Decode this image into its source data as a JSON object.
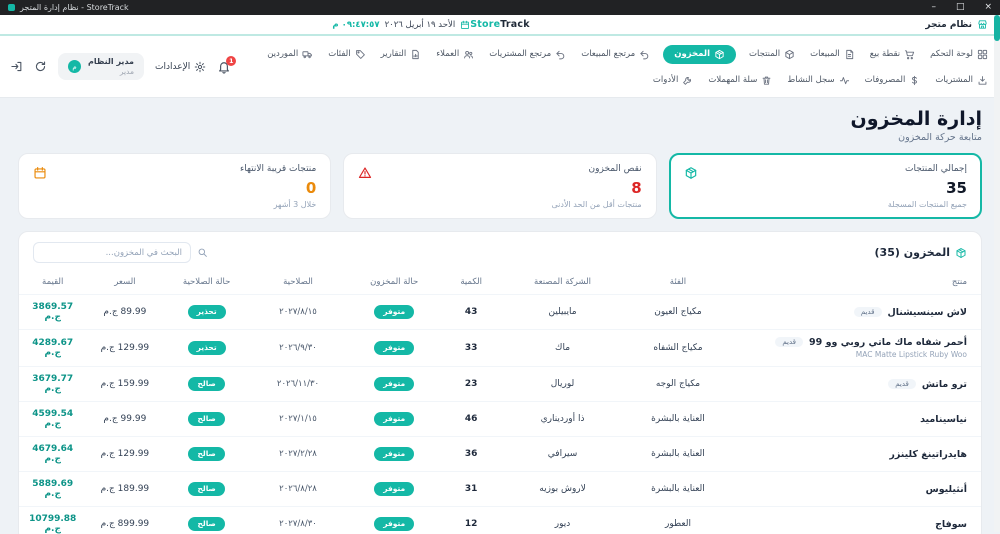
{
  "window": {
    "title": "نظام إدارة المتجر - StoreTrack",
    "minimize": "–",
    "maximize": "□",
    "close": "×"
  },
  "app_header": {
    "system_label": "نظام متجر",
    "brand_store": "Store",
    "brand_track": "Track",
    "date": "الأحد ١٩ أبريل ٢٠٢٦",
    "time": "٠٩:٤٧:٥٧ م"
  },
  "nav": {
    "row1": [
      {
        "label": "لوحة التحكم",
        "icon": "dashboard",
        "active": false
      },
      {
        "label": "نقطة بيع",
        "icon": "pos",
        "active": false
      },
      {
        "label": "المبيعات",
        "icon": "sales",
        "active": false
      },
      {
        "label": "المنتجات",
        "icon": "products",
        "active": false
      },
      {
        "label": "المخزون",
        "icon": "inventory",
        "active": true
      },
      {
        "label": "مرتجع المبيعات",
        "icon": "returns",
        "active": false
      },
      {
        "label": "مرتجع المشتريات",
        "icon": "returns",
        "active": false
      },
      {
        "label": "العملاء",
        "icon": "customers",
        "active": false
      },
      {
        "label": "التقارير",
        "icon": "reports",
        "active": false
      },
      {
        "label": "الفئات",
        "icon": "categories",
        "active": false
      },
      {
        "label": "الموردين",
        "icon": "suppliers",
        "active": false
      }
    ],
    "row2": [
      {
        "label": "المشتريات",
        "icon": "purchases",
        "active": false
      },
      {
        "label": "المصروفات",
        "icon": "expenses",
        "active": false
      },
      {
        "label": "سجل النشاط",
        "icon": "activity",
        "active": false
      },
      {
        "label": "سلة المهملات",
        "icon": "trash",
        "active": false
      },
      {
        "label": "الأدوات",
        "icon": "tools",
        "active": false
      }
    ],
    "actions": {
      "settings_label": "الإعدادات",
      "notification_count": "1",
      "user_name": "مدير النظام",
      "user_role": "مدير",
      "avatar_letter": "م"
    }
  },
  "page": {
    "title": "إدارة المخزون",
    "subtitle": "متابعة حركة المخزون"
  },
  "stats_cards": [
    {
      "id": "total-products",
      "title": "إجمالي المنتجات",
      "value": "35",
      "sub": "جميع المنتجات المسجلة",
      "icon": "inventory",
      "accent": "teal",
      "value_class": "",
      "active": true
    },
    {
      "id": "low-stock",
      "title": "نقص المخزون",
      "value": "8",
      "sub": "منتجات أقل من الحد الأدنى",
      "icon": "warning",
      "accent": "red",
      "value_class": "v-red",
      "active": false
    },
    {
      "id": "near-expiry",
      "title": "منتجات قريبة الانتهاء",
      "value": "0",
      "sub": "خلال 3 أشهر",
      "icon": "calendar",
      "accent": "orange",
      "value_class": "v-orange",
      "active": false
    }
  ],
  "inventory": {
    "section_title": "المخزون (35)",
    "search_placeholder": "البحث في المخزون...",
    "columns": [
      "منتج",
      "الفئة",
      "الشركة المصنعة",
      "الكمية",
      "حالة المخزون",
      "الصلاحية",
      "حالة الصلاحية",
      "السعر",
      "القيمة"
    ],
    "rows": [
      {
        "product": "لاش سينسيشنال",
        "badge": "قديم",
        "subtitle": "",
        "category": "مكياج العيون",
        "manufacturer": "مايبيلين",
        "quantity": "43",
        "stock_status": "متوفر",
        "expiry": "٢٠٢٧/٨/١٥",
        "expiry_status": "تحذير",
        "price": "89.99 ج.م",
        "value": "3869.57 ج.م"
      },
      {
        "product": "أحمر شفاه ماك ماتي روبي وو 99",
        "badge": "قديم",
        "subtitle": "MAC Matte Lipstick Ruby Woo",
        "category": "مكياج الشفاه",
        "manufacturer": "ماك",
        "quantity": "33",
        "stock_status": "متوفر",
        "expiry": "٢٠٢٦/٩/٣٠",
        "expiry_status": "تحذير",
        "price": "129.99 ج.م",
        "value": "4289.67 ج.م"
      },
      {
        "product": "ترو ماتش",
        "badge": "قديم",
        "subtitle": "",
        "category": "مكياج الوجه",
        "manufacturer": "لوريال",
        "quantity": "23",
        "stock_status": "متوفر",
        "expiry": "٢٠٢٦/١١/٣٠",
        "expiry_status": "صالح",
        "price": "159.99 ج.م",
        "value": "3679.77 ج.م"
      },
      {
        "product": "نياسيناميد",
        "badge": "",
        "subtitle": "",
        "category": "العناية بالبشرة",
        "manufacturer": "ذا أورديناري",
        "quantity": "46",
        "stock_status": "متوفر",
        "expiry": "٢٠٢٧/١/١٥",
        "expiry_status": "صالح",
        "price": "99.99 ج.م",
        "value": "4599.54 ج.م"
      },
      {
        "product": "هايدراتينغ كلينزر",
        "badge": "",
        "subtitle": "",
        "category": "العناية بالبشرة",
        "manufacturer": "سيرافي",
        "quantity": "36",
        "stock_status": "متوفر",
        "expiry": "٢٠٢٧/٢/٢٨",
        "expiry_status": "صالح",
        "price": "129.99 ج.م",
        "value": "4679.64 ج.م"
      },
      {
        "product": "أنثيليوس",
        "badge": "",
        "subtitle": "",
        "category": "العناية بالبشرة",
        "manufacturer": "لاروش بوزيه",
        "quantity": "31",
        "stock_status": "متوفر",
        "expiry": "٢٠٢٦/٨/٢٨",
        "expiry_status": "صالح",
        "price": "189.99 ج.م",
        "value": "5889.69 ج.م"
      },
      {
        "product": "سوفاج",
        "badge": "",
        "subtitle": "",
        "category": "العطور",
        "manufacturer": "ديور",
        "quantity": "12",
        "stock_status": "متوفر",
        "expiry": "٢٠٢٧/٨/٣٠",
        "expiry_status": "صالح",
        "price": "899.99 ج.م",
        "value": "10799.88 ج.م"
      }
    ]
  },
  "colors": {
    "accent_teal": "#14b8a6",
    "danger_red": "#dc2626",
    "warn_orange": "#ea8a0b",
    "value_teal": "#0d9488",
    "notification_red": "#ef4444"
  }
}
